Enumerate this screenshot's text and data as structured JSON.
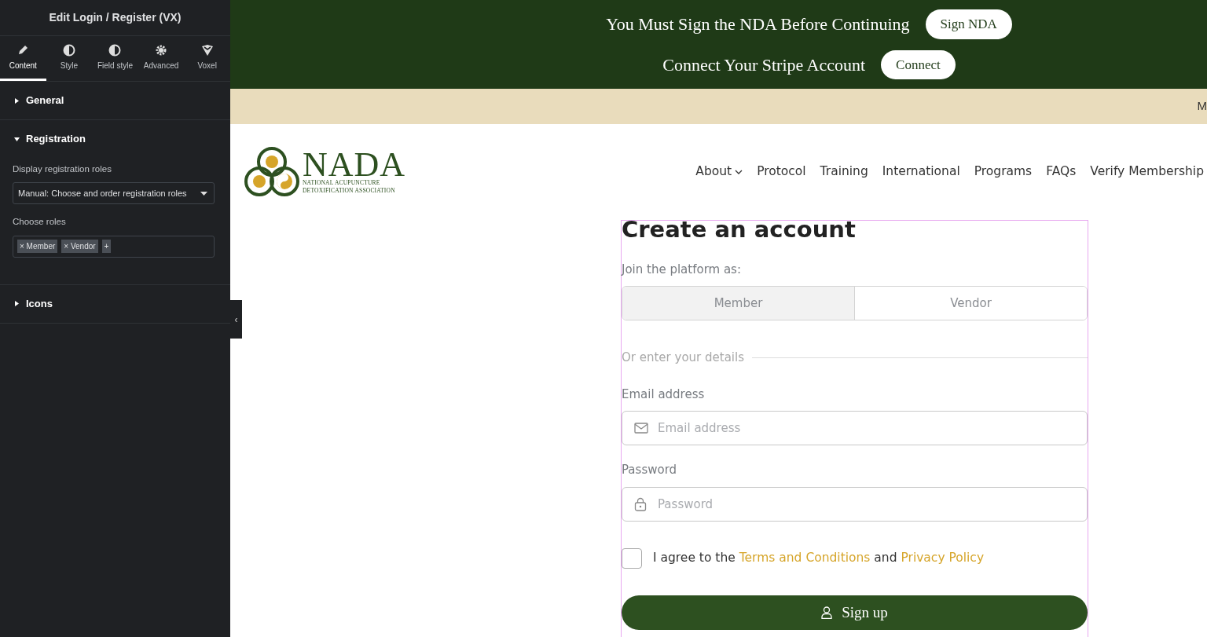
{
  "editor": {
    "title": "Edit Login / Register (VX)",
    "tabs": [
      {
        "label": "Content",
        "kind": "pencil",
        "selected": true
      },
      {
        "label": "Style",
        "kind": "contrast",
        "selected": false
      },
      {
        "label": "Field style",
        "kind": "contrast",
        "selected": false
      },
      {
        "label": "Advanced",
        "kind": "gear",
        "selected": false
      },
      {
        "label": "Voxel",
        "kind": "voxel",
        "selected": false
      }
    ],
    "sections": [
      {
        "title": "General",
        "expanded": false
      },
      {
        "title": "Registration",
        "expanded": true,
        "controls": [
          {
            "kind": "select",
            "label": "Display registration roles",
            "value": "Manual: Choose and order registration roles"
          },
          {
            "kind": "tags",
            "label": "Choose roles",
            "tags": [
              "× Member",
              "× Vendor"
            ],
            "add": "+"
          }
        ]
      },
      {
        "title": "Icons",
        "expanded": false
      }
    ],
    "collapse_handle": "‹"
  },
  "site": {
    "notices": [
      {
        "text": "You Must Sign the NDA Before Continuing",
        "button": "Sign NDA"
      },
      {
        "text": "Connect Your Stripe Account",
        "button": "Connect"
      }
    ],
    "ticker": "M",
    "logo": {
      "name": "NADA",
      "line_1": "NATIONAL ACUPUNCTURE",
      "line_2": "DETOXIFICATION ASSOCIATION"
    },
    "menu": [
      {
        "label": "About",
        "dropdown": true
      },
      {
        "label": "Protocol",
        "dropdown": false
      },
      {
        "label": "Training",
        "dropdown": false
      },
      {
        "label": "International",
        "dropdown": false
      },
      {
        "label": "Programs",
        "dropdown": false
      },
      {
        "label": "FAQs",
        "dropdown": false
      },
      {
        "label": "Verify Membership",
        "dropdown": false
      }
    ]
  },
  "form": {
    "title": "Create an account",
    "join_label": "Join the platform as:",
    "roles": [
      {
        "label": "Member",
        "selected": true
      },
      {
        "label": "Vendor",
        "selected": false
      }
    ],
    "divider": "Or enter your details",
    "fields": [
      {
        "label": "Email address",
        "placeholder": "Email address",
        "kind": "email"
      },
      {
        "label": "Password",
        "placeholder": "Password",
        "kind": "password"
      }
    ],
    "agree": {
      "checked": false,
      "text": "I agree to the",
      "link_1": "Terms and Conditions",
      "joiner": "and",
      "link_2": "Privacy Policy"
    },
    "submit": "Sign up"
  }
}
